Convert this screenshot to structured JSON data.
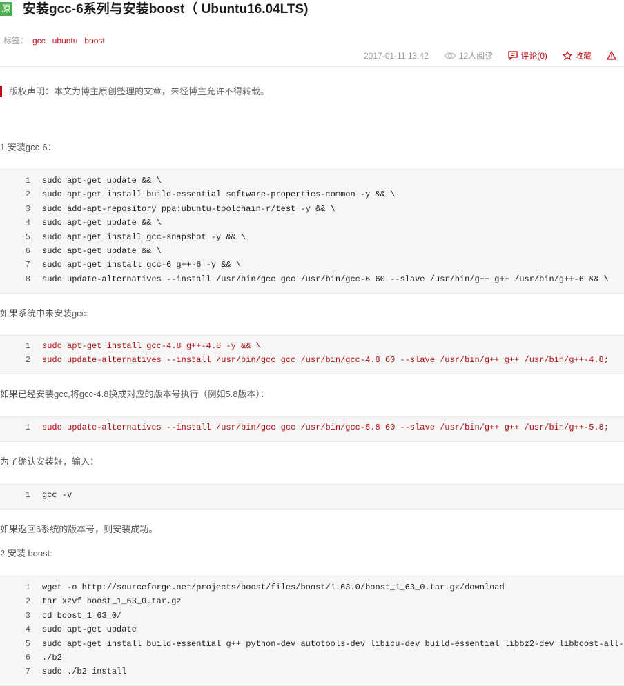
{
  "article": {
    "badge": "原",
    "title": "安装gcc-6系列与安装boost（ Ubuntu16.04LTS)",
    "tags_label": "标签：",
    "tags": [
      "gcc",
      "ubuntu",
      "boost"
    ],
    "date": "2017-01-11 13:42",
    "views": "12人阅读",
    "comments": "评论(0)",
    "favorite": "收藏",
    "notice": "版权声明：本文为博主原创整理的文章，未经博主允许不得转载。"
  },
  "sections": {
    "s1": "1.安装gcc-6：",
    "s2": "如果系统中未安装gcc:",
    "s3": "如果已经安装gcc,将gcc-4.8换成对应的版本号执行（例如5.8版本）：",
    "s4": "为了确认安装好，输入：",
    "s5": "如果返回6系统的版本号，则安装成功。",
    "s6": "2.安装 boost:"
  },
  "code1": [
    "sudo apt-get update && \\",
    "sudo apt-get install build-essential software-properties-common -y && \\",
    "sudo add-apt-repository ppa:ubuntu-toolchain-r/test -y && \\",
    "sudo apt-get update && \\",
    "sudo apt-get install gcc-snapshot -y && \\",
    "sudo apt-get update && \\",
    "sudo apt-get install gcc-6 g++-6 -y && \\",
    "sudo update-alternatives --install /usr/bin/gcc gcc /usr/bin/gcc-6 60 --slave /usr/bin/g++ g++ /usr/bin/g++-6 && \\"
  ],
  "code2": [
    "sudo apt-get install gcc-4.8 g++-4.8 -y && \\",
    "sudo update-alternatives --install /usr/bin/gcc gcc /usr/bin/gcc-4.8 60 --slave /usr/bin/g++ g++ /usr/bin/g++-4.8;"
  ],
  "code3": [
    "sudo update-alternatives --install /usr/bin/gcc gcc /usr/bin/gcc-5.8 60 --slave /usr/bin/g++ g++ /usr/bin/g++-5.8;"
  ],
  "code4": [
    "gcc -v"
  ],
  "code5": [
    "wget -o http://sourceforge.net/projects/boost/files/boost/1.63.0/boost_1_63_0.tar.gz/download",
    "tar xzvf boost_1_63_0.tar.gz",
    "cd boost_1_63_0/",
    "sudo apt-get update",
    "sudo apt-get install build-essential g++ python-dev autotools-dev libicu-dev build-essential libbz2-dev libboost-all-dev",
    "./b2",
    "sudo ./b2 install"
  ]
}
